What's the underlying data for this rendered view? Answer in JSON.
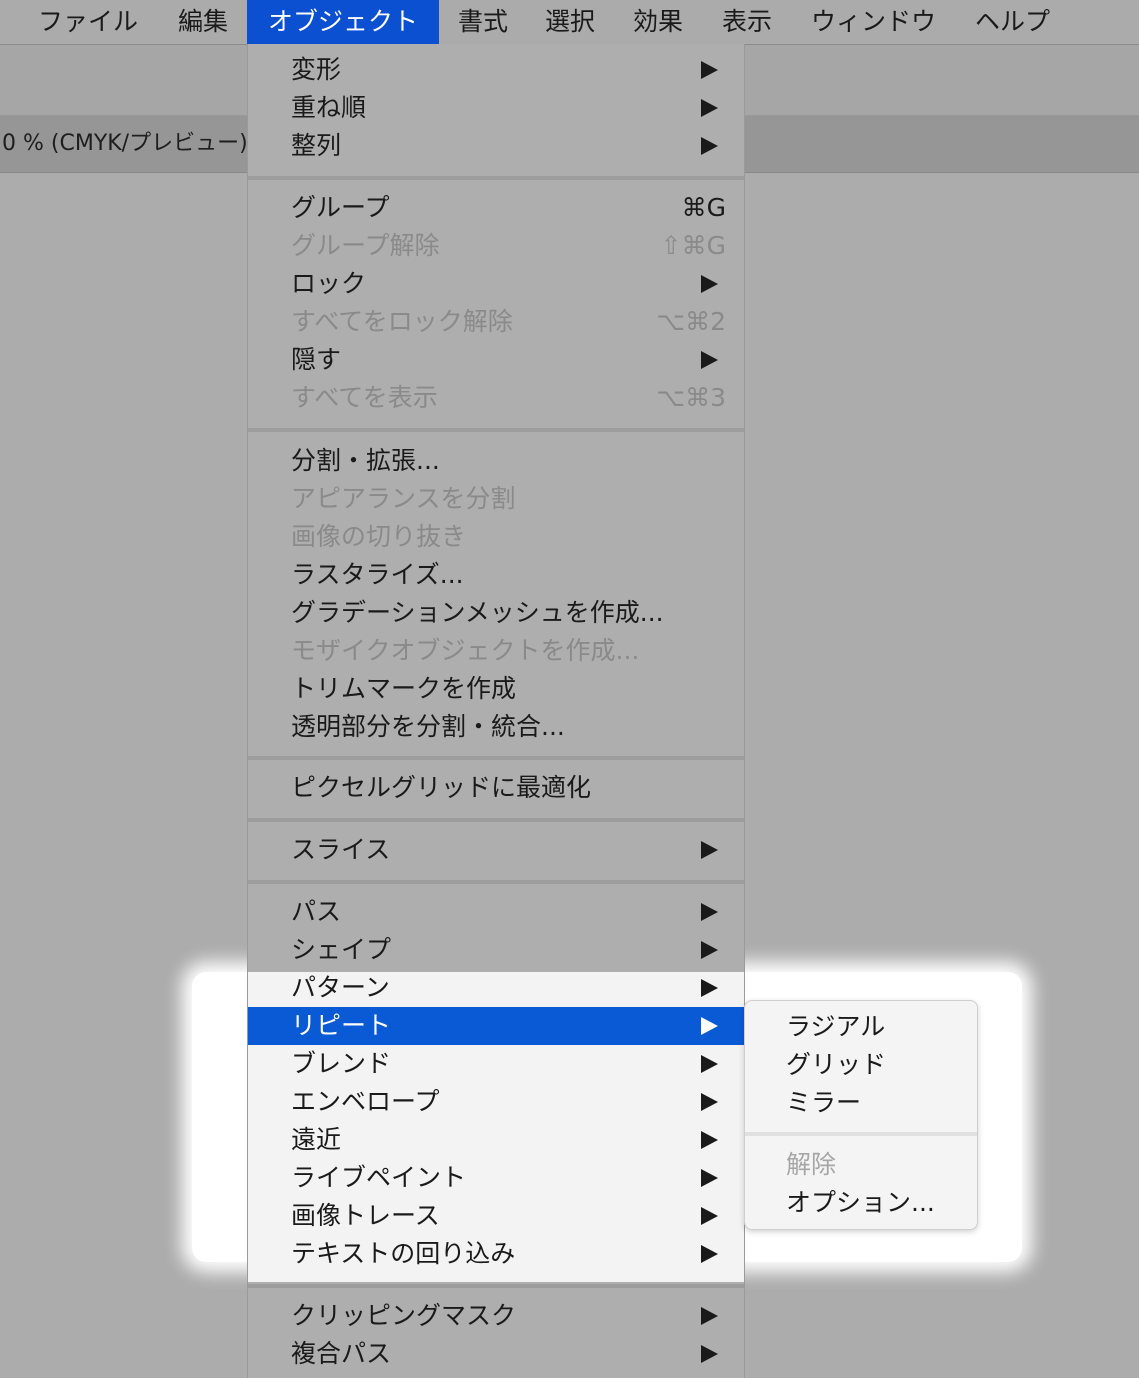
{
  "menubar": {
    "items": [
      {
        "label": "ファイル"
      },
      {
        "label": "編集"
      },
      {
        "label": "オブジェクト"
      },
      {
        "label": "書式"
      },
      {
        "label": "選択"
      },
      {
        "label": "効果"
      },
      {
        "label": "表示"
      },
      {
        "label": "ウィンドウ"
      },
      {
        "label": "ヘルプ"
      }
    ],
    "active_item": "オブジェクト"
  },
  "document": {
    "tab_label": "0 % (CMYK/プレビュー)"
  },
  "object_menu": {
    "groups": [
      [
        {
          "label": "変形",
          "submenu": true
        },
        {
          "label": "重ね順",
          "submenu": true
        },
        {
          "label": "整列",
          "submenu": true
        }
      ],
      [
        {
          "label": "グループ",
          "shortcut": "⌘G"
        },
        {
          "label": "グループ解除",
          "shortcut": "⇧⌘G",
          "disabled": true
        },
        {
          "label": "ロック",
          "submenu": true
        },
        {
          "label": "すべてをロック解除",
          "shortcut": "⌥⌘2",
          "disabled": true
        },
        {
          "label": "隠す",
          "submenu": true
        },
        {
          "label": "すべてを表示",
          "shortcut": "⌥⌘3",
          "disabled": true
        }
      ],
      [
        {
          "label": "分割・拡張..."
        },
        {
          "label": "アピアランスを分割",
          "disabled": true
        },
        {
          "label": "画像の切り抜き",
          "disabled": true
        },
        {
          "label": "ラスタライズ..."
        },
        {
          "label": "グラデーションメッシュを作成..."
        },
        {
          "label": "モザイクオブジェクトを作成...",
          "disabled": true
        },
        {
          "label": "トリムマークを作成"
        },
        {
          "label": "透明部分を分割・統合..."
        }
      ],
      [
        {
          "label": "ピクセルグリッドに最適化"
        }
      ],
      [
        {
          "label": "スライス",
          "submenu": true
        }
      ],
      [
        {
          "label": "パス",
          "submenu": true
        },
        {
          "label": "シェイプ",
          "submenu": true
        },
        {
          "label": "パターン",
          "submenu": true
        },
        {
          "label": "リピート",
          "submenu": true,
          "highlighted": true
        },
        {
          "label": "ブレンド",
          "submenu": true
        },
        {
          "label": "エンベロープ",
          "submenu": true
        },
        {
          "label": "遠近",
          "submenu": true
        },
        {
          "label": "ライブペイント",
          "submenu": true
        },
        {
          "label": "画像トレース",
          "submenu": true
        },
        {
          "label": "テキストの回り込み",
          "submenu": true
        }
      ],
      [
        {
          "label": "クリッピングマスク",
          "submenu": true
        },
        {
          "label": "複合パス",
          "submenu": true
        }
      ]
    ]
  },
  "repeat_submenu": {
    "items": [
      {
        "label": "ラジアル"
      },
      {
        "label": "グリッド"
      },
      {
        "label": "ミラー"
      },
      {
        "label": "解除",
        "disabled": true
      },
      {
        "label": "オプション..."
      }
    ]
  },
  "colors": {
    "selection_blue": "#0a5ad6",
    "menubar_active": "#0a50d0",
    "disabled_text": "#8a8a8a"
  }
}
